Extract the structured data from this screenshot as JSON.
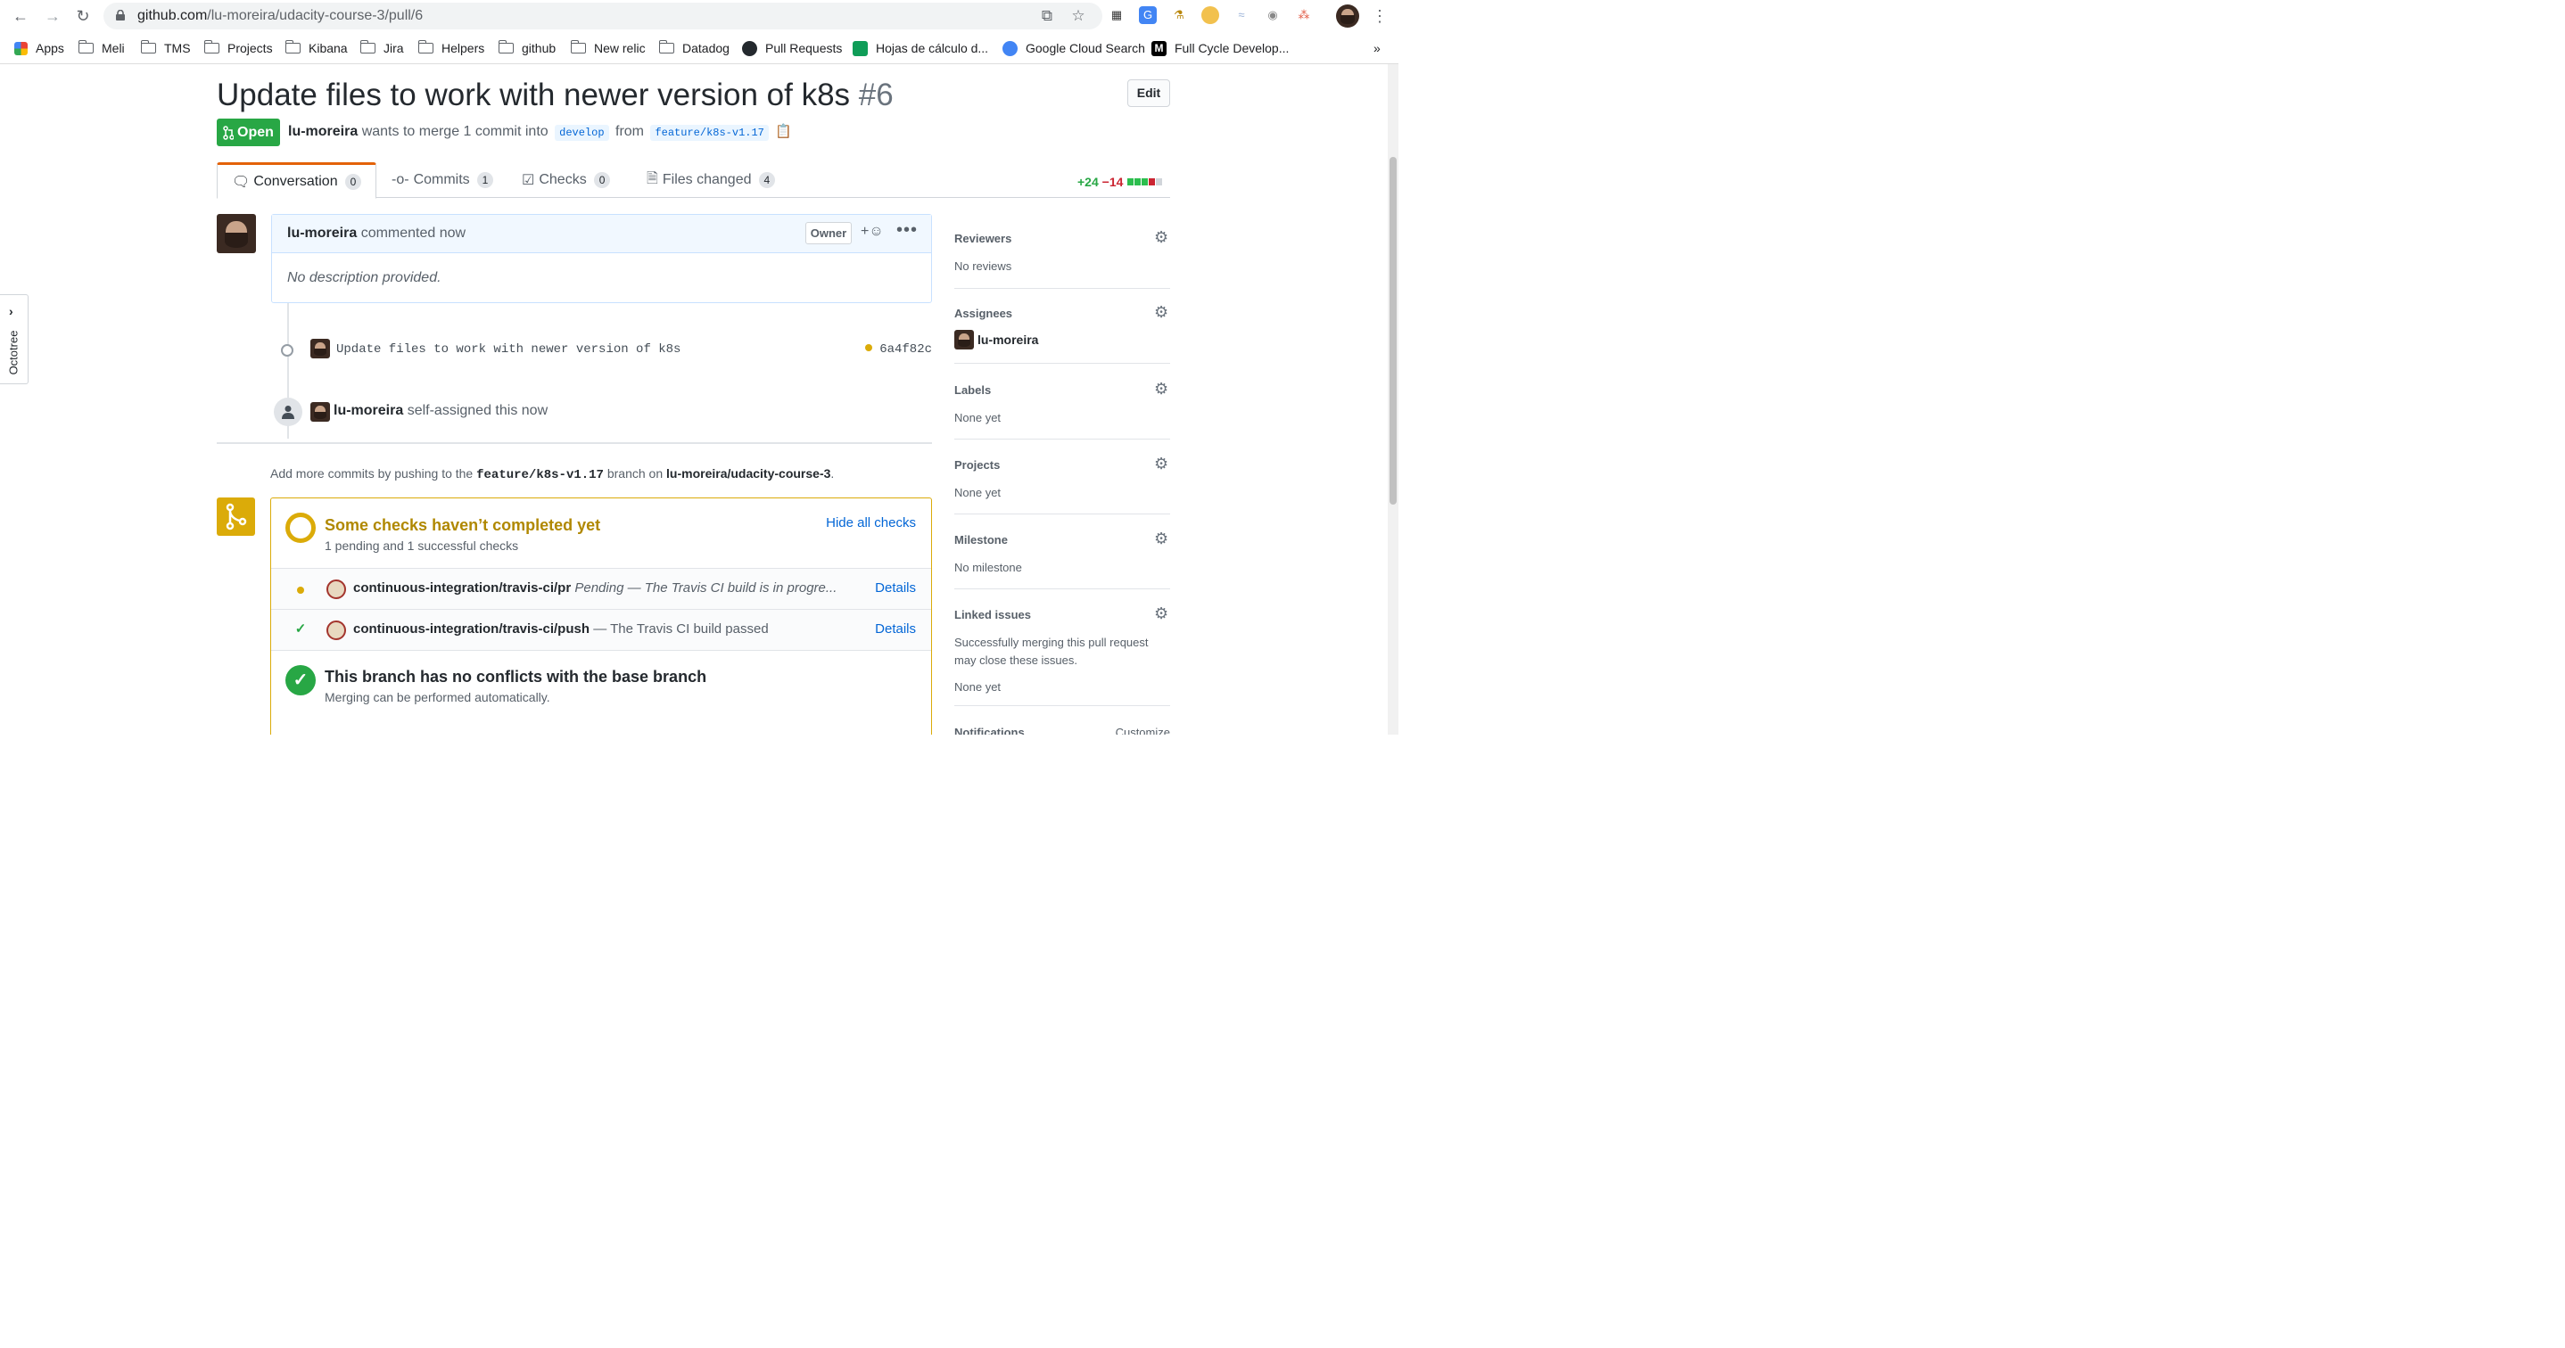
{
  "browser": {
    "url_host": "github.com",
    "url_path": "/lu-moreira/udacity-course-3/pull/6",
    "bookmarks": [
      {
        "label": "Apps",
        "icon": "apps-grid-icon"
      },
      {
        "label": "Meli",
        "icon": "folder-icon"
      },
      {
        "label": "TMS",
        "icon": "folder-icon"
      },
      {
        "label": "Projects",
        "icon": "folder-icon"
      },
      {
        "label": "Kibana",
        "icon": "folder-icon"
      },
      {
        "label": "Jira",
        "icon": "folder-icon"
      },
      {
        "label": "Helpers",
        "icon": "folder-icon"
      },
      {
        "label": "github",
        "icon": "folder-icon"
      },
      {
        "label": "New relic",
        "icon": "folder-icon"
      },
      {
        "label": "Datadog",
        "icon": "folder-icon"
      },
      {
        "label": "Pull Requests",
        "icon": "github-icon"
      },
      {
        "label": "Hojas de cálculo d...",
        "icon": "sheets-icon"
      },
      {
        "label": "Google Cloud Search",
        "icon": "cloud-search-icon"
      },
      {
        "label": "Full Cycle Develop...",
        "icon": "medium-icon"
      }
    ],
    "more": "»"
  },
  "pr": {
    "title": "Update files to work with newer version of k8s",
    "number": "#6",
    "edit_label": "Edit",
    "state": "Open",
    "author": "lu-moreira",
    "merge_text": "wants to merge 1 commit into",
    "base": "develop",
    "from_text": "from",
    "head": "feature/k8s-v1.17"
  },
  "tabs": [
    {
      "label": "Conversation",
      "count": "0"
    },
    {
      "label": "Commits",
      "count": "1"
    },
    {
      "label": "Checks",
      "count": "0"
    },
    {
      "label": "Files changed",
      "count": "4"
    }
  ],
  "diffstat": {
    "additions": "+24",
    "deletions": "−14"
  },
  "comment": {
    "author": "lu-moreira",
    "action": "commented now",
    "owner_label": "Owner",
    "react": "+☺",
    "more": "•••",
    "body": "No description provided."
  },
  "commit_event": {
    "message": "Update files to work with newer version of k8s",
    "sha": "6a4f82c"
  },
  "assign_event": {
    "user": "lu-moreira",
    "text": "self-assigned this now"
  },
  "push_hint": {
    "prefix": "Add more commits by pushing to the",
    "branch": "feature/k8s-v1.17",
    "middle": "branch on",
    "repo": "lu-moreira/udacity-course-3",
    "suffix": "."
  },
  "checks": {
    "title": "Some checks haven’t completed yet",
    "subtitle": "1 pending and 1 successful checks",
    "hide_label": "Hide all checks",
    "items": [
      {
        "name": "continuous-integration/travis-ci/pr",
        "desc": "Pending — The Travis CI build is in progre...",
        "details": "Details",
        "status": "pending"
      },
      {
        "name": "continuous-integration/travis-ci/push",
        "desc": "— The Travis CI build passed",
        "details": "Details",
        "status": "success"
      }
    ],
    "merge_title": "This branch has no conflicts with the base branch",
    "merge_sub": "Merging can be performed automatically."
  },
  "sidebar": {
    "reviewers": {
      "title": "Reviewers",
      "value": "No reviews"
    },
    "assignees": {
      "title": "Assignees",
      "value": "lu-moreira"
    },
    "labels": {
      "title": "Labels",
      "value": "None yet"
    },
    "projects": {
      "title": "Projects",
      "value": "None yet"
    },
    "milestone": {
      "title": "Milestone",
      "value": "No milestone"
    },
    "linked": {
      "title": "Linked issues",
      "value": "Successfully merging this pull request may close these issues.",
      "value2": "None yet"
    },
    "notifications": {
      "title": "Notifications",
      "action": "Customize"
    }
  },
  "octotree": {
    "label": "Octotree",
    "chevron": "›"
  },
  "colors": {
    "open_green": "#28a745",
    "pending_yellow": "#dbab09",
    "link_blue": "#0366d6",
    "deletion_red": "#cb2431"
  }
}
